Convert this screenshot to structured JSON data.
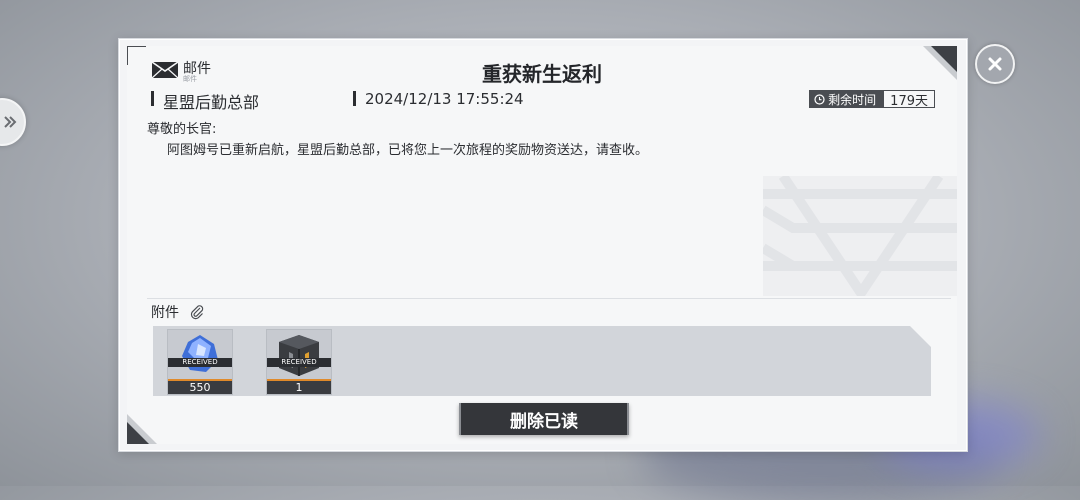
{
  "header": {
    "mail_label": "邮件",
    "mail_sub": "邮件",
    "title": "重获新生返利"
  },
  "meta": {
    "sender": "星盟后勤总部",
    "date": "2024/12/13 17:55:24",
    "timer_label": "剩余时间",
    "timer_value": "179天"
  },
  "message": {
    "greeting": "尊敬的长官:",
    "body": "阿图姆号已重新启航，星盟后勤总部，已将您上一次旅程的奖励物资送达，请查收。"
  },
  "attachments": {
    "label": "附件",
    "items": [
      {
        "status": "RECEIVED",
        "count": "550",
        "icon": "blue-crystal-icon"
      },
      {
        "status": "RECEIVED",
        "count": "1",
        "icon": "armor-box-icon"
      }
    ]
  },
  "actions": {
    "delete_label": "删除已读"
  },
  "colors": {
    "accent_dark": "#34363a",
    "orange": "#e08a2a",
    "crystal_blue": "#5b8cf0"
  }
}
